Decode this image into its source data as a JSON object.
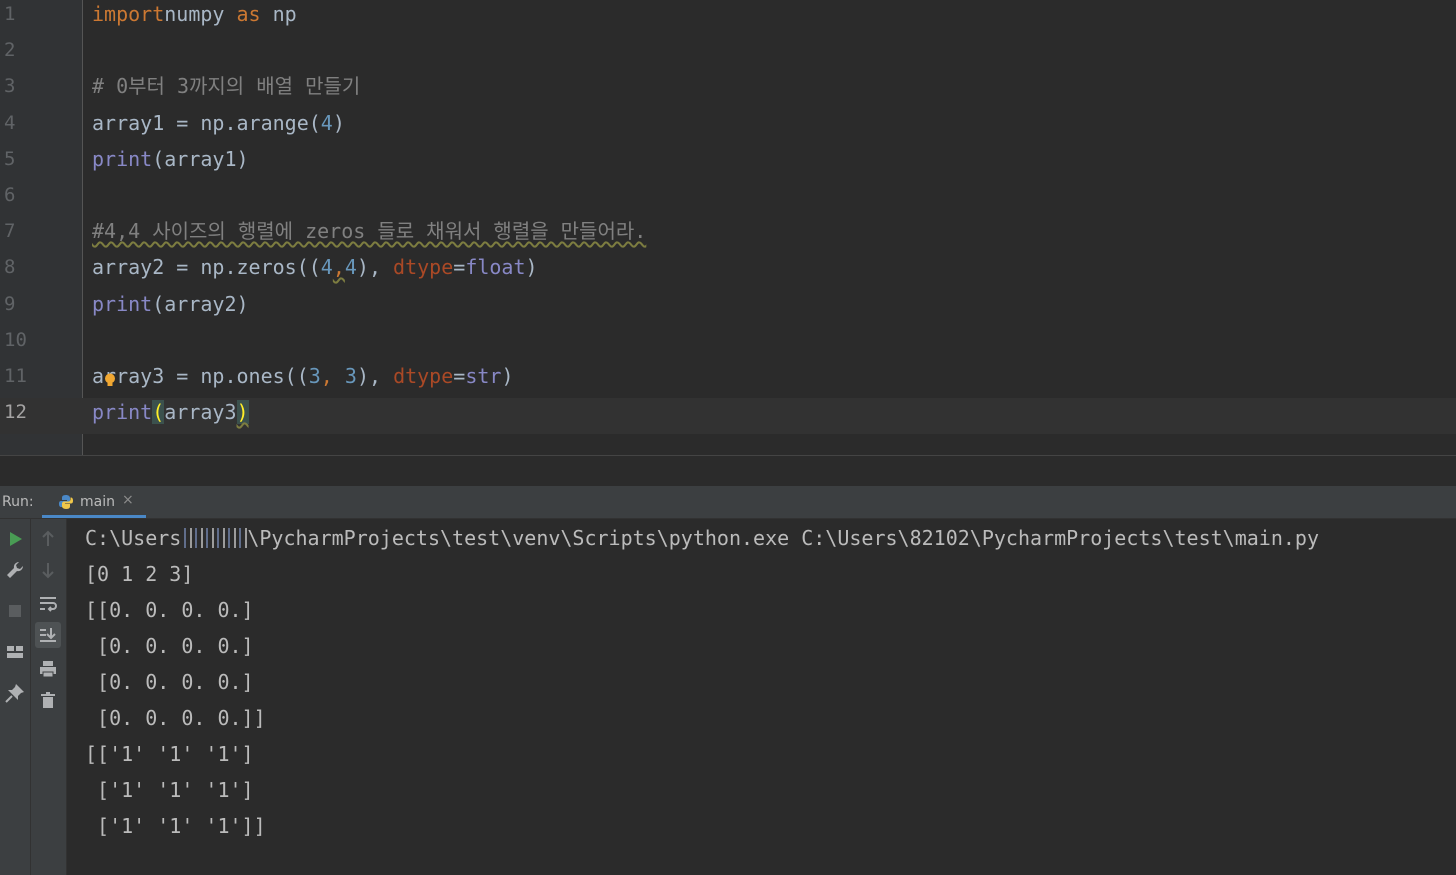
{
  "editor": {
    "lines": [
      {
        "n": "1",
        "tokens": [
          [
            "kw",
            "import"
          ],
          [
            "",
            "numpy "
          ],
          [
            "kw",
            "as"
          ],
          [
            "",
            " np"
          ]
        ]
      },
      {
        "n": "2",
        "tokens": []
      },
      {
        "n": "3",
        "tokens": [
          [
            "cm",
            "# 0부터 3까지의 배열 만들기"
          ]
        ]
      },
      {
        "n": "4",
        "tokens": [
          [
            "",
            "array1 = np.arange("
          ],
          [
            "num",
            "4"
          ],
          [
            "",
            ")"
          ]
        ]
      },
      {
        "n": "5",
        "tokens": [
          [
            "fn",
            "print"
          ],
          [
            "",
            "(array1)"
          ]
        ]
      },
      {
        "n": "6",
        "tokens": []
      },
      {
        "n": "7",
        "tokens": [
          [
            "cm wavy",
            "#4,4 사이즈의 행렬에 zeros 들로 채워서 행렬을 만들어라."
          ]
        ]
      },
      {
        "n": "8",
        "tokens": [
          [
            "",
            "array2 = np.zeros(("
          ],
          [
            "num",
            "4"
          ],
          [
            "kw wavy",
            ","
          ],
          [
            "num",
            "4"
          ],
          [
            "",
            "), "
          ],
          [
            "prm",
            "dtype"
          ],
          [
            "",
            "="
          ],
          [
            "bi",
            "float"
          ],
          [
            "",
            ")"
          ]
        ]
      },
      {
        "n": "9",
        "tokens": [
          [
            "fn",
            "print"
          ],
          [
            "",
            "(array2)"
          ]
        ]
      },
      {
        "n": "10",
        "tokens": []
      },
      {
        "n": "11",
        "tokens": [
          [
            "",
            "array3 = np.ones(("
          ],
          [
            "num",
            "3"
          ],
          [
            "kw",
            ", "
          ],
          [
            "num",
            "3"
          ],
          [
            "",
            "), "
          ],
          [
            "prm",
            "dtype"
          ],
          [
            "",
            "="
          ],
          [
            "bi",
            "str"
          ],
          [
            "",
            ")"
          ]
        ]
      },
      {
        "n": "12",
        "tokens": [
          [
            "fn",
            "print"
          ],
          [
            "brk",
            "("
          ],
          [
            "",
            "array3"
          ],
          [
            "brk wavy",
            ")"
          ]
        ]
      }
    ]
  },
  "run_panel": {
    "label": "Run:",
    "tab_label": "main",
    "close_glyph": "×"
  },
  "console": {
    "cmd_prefix": "C:\\Users",
    "cmd_suffix": "\\PycharmProjects\\test\\venv\\Scripts\\python.exe C:\\Users\\82102\\PycharmProjects\\test\\main.py",
    "output": [
      "[0 1 2 3]",
      "[[0. 0. 0. 0.]",
      " [0. 0. 0. 0.]",
      " [0. 0. 0. 0.]",
      " [0. 0. 0. 0.]]",
      "[['1' '1' '1']",
      " ['1' '1' '1']",
      " ['1' '1' '1']]"
    ]
  },
  "colors": {
    "editor_bg": "#2b2b2b",
    "keyword": "#cc7832",
    "builtin": "#8888c6",
    "number": "#6897bb",
    "comment": "#808080",
    "param": "#aa4926",
    "tab_underline": "#4a88c7",
    "run_green": "#499c54"
  },
  "icons": {
    "run": "play-icon",
    "settings": "wrench-icon",
    "stop": "stop-icon",
    "layout": "layout-icon",
    "pin": "pin-icon",
    "up": "arrow-up-icon",
    "down": "arrow-down-icon",
    "wrap": "soft-wrap-icon",
    "scroll": "scroll-to-end-icon",
    "print": "print-icon",
    "trash": "trash-icon",
    "python": "python-icon",
    "bulb": "lightbulb-icon"
  }
}
